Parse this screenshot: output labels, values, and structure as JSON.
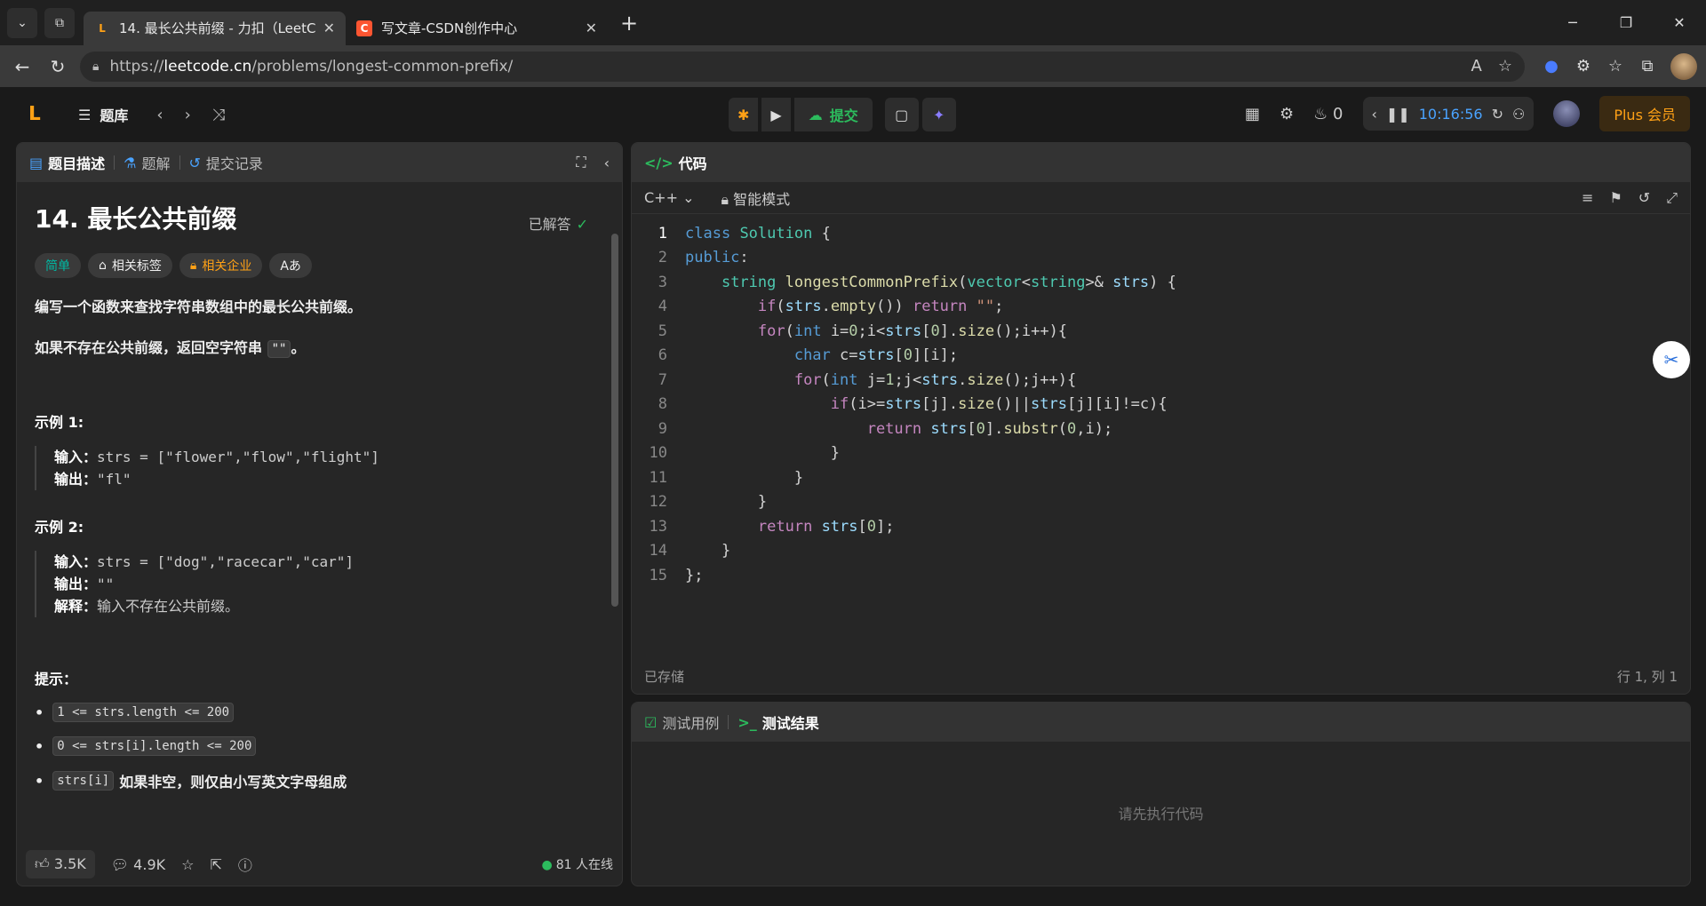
{
  "browser": {
    "tabs": [
      {
        "title": "14. 最长公共前缀 - 力扣（LeetCode）",
        "active": true
      },
      {
        "title": "写文章-CSDN创作中心",
        "active": false
      }
    ],
    "url": {
      "scheme": "https://",
      "host": "leetcode.cn",
      "path": "/problems/longest-common-prefix/"
    }
  },
  "topbar": {
    "library": "题库",
    "submit": "提交",
    "fire_count": "0",
    "timer": "10:16:56",
    "plus": "Plus 会员"
  },
  "left_panel": {
    "tabs": [
      "题目描述",
      "题解",
      "提交记录"
    ],
    "title": "14. 最长公共前缀",
    "status": "已解答",
    "tags": [
      "简单",
      "相关标签",
      "相关企业"
    ],
    "font_tag": "Aあ",
    "desc1": "编写一个函数来查找字符串数组中的最长公共前缀。",
    "desc2_pre": "如果不存在公共前缀，返回空字符串 ",
    "desc2_code": "\"\"",
    "desc2_post": "。",
    "example1": {
      "title": "示例 1:",
      "input_label": "输入：",
      "input": "strs = [\"flower\",\"flow\",\"flight\"]",
      "output_label": "输出：",
      "output": "\"fl\""
    },
    "example2": {
      "title": "示例 2:",
      "input_label": "输入：",
      "input": "strs = [\"dog\",\"racecar\",\"car\"]",
      "output_label": "输出：",
      "output": "\"\"",
      "explain_label": "解释：",
      "explain": "输入不存在公共前缀。"
    },
    "hint_title": "提示：",
    "hints": [
      {
        "code": "1 <= strs.length <= 200",
        "text": ""
      },
      {
        "code": "0 <= strs[i].length <= 200",
        "text": ""
      },
      {
        "code": "strs[i]",
        "text": "如果非空，则仅由小写英文字母组成"
      }
    ],
    "footer": {
      "likes": "3.5K",
      "comments": "4.9K",
      "online": "81 人在线"
    }
  },
  "code_panel": {
    "title": "代码",
    "language": "C++",
    "mode": "智能模式",
    "saved": "已存储",
    "position": "行 1, 列 1"
  },
  "test_panel": {
    "tabs": [
      "测试用例",
      "测试结果"
    ],
    "empty": "请先执行代码"
  }
}
